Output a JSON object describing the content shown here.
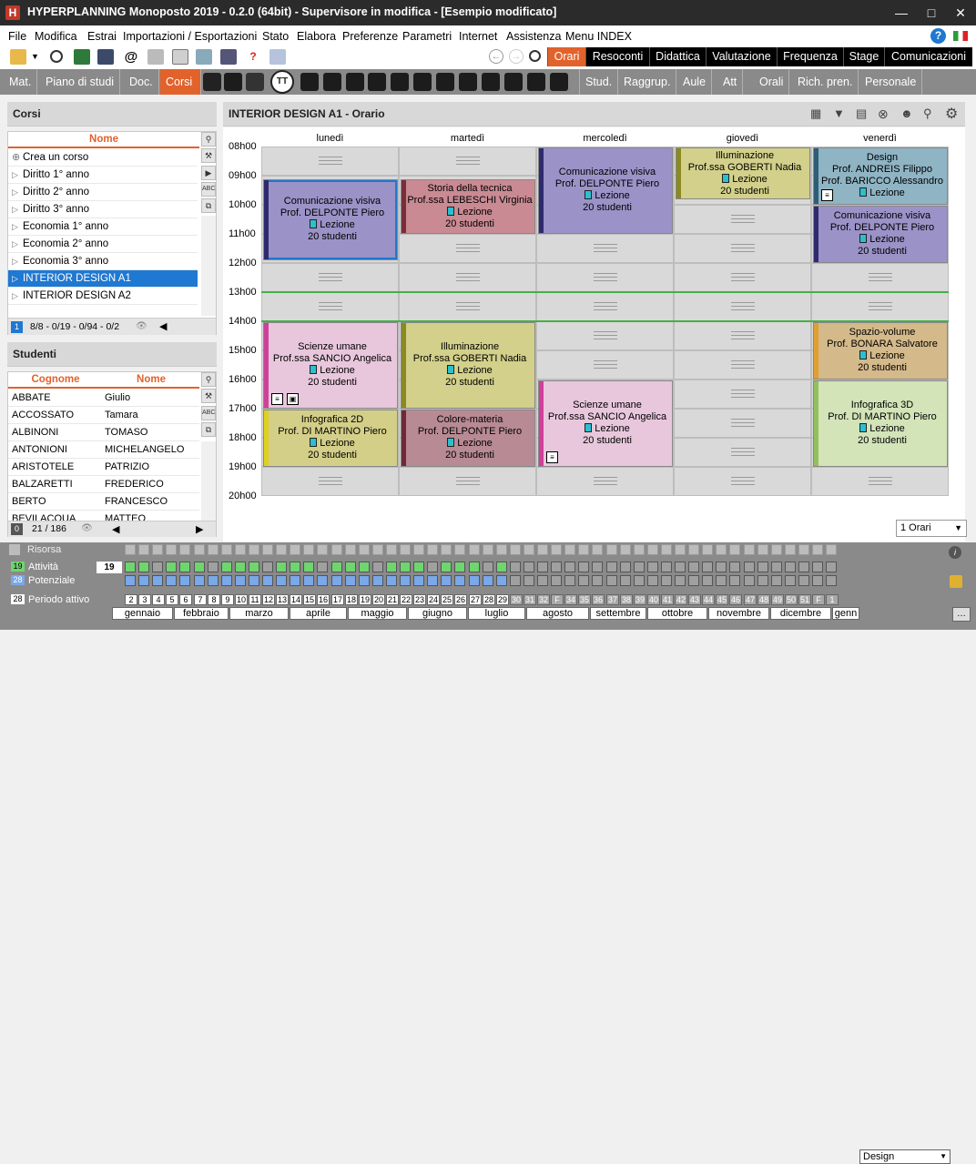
{
  "window": {
    "title": "HYPERPLANNING Monoposto 2019 - 0.2.0 (64bit) - Supervisore in modifica - [Esempio modificato]",
    "logo": "H"
  },
  "menu": [
    "File",
    "Modifica",
    "Estrai",
    "Importazioni / Esportazioni",
    "Stato",
    "Elabora",
    "Preferenze",
    "Parametri",
    "Internet",
    "Assistenza",
    "Menu INDEX"
  ],
  "top_tabs": [
    "Orari",
    "Resoconti",
    "Didattica",
    "Valutazione",
    "Frequenza",
    "Stage",
    "Comunicazioni"
  ],
  "nav2_left": [
    "Mat.",
    "Piano di studi",
    "Doc.",
    "Corsi"
  ],
  "nav2_right": [
    "Stud.",
    "Raggrup.",
    "Aule",
    "Att",
    "Orali",
    "Rich. pren.",
    "Personale"
  ],
  "corsi": {
    "header": "Corsi",
    "column": "Nome",
    "items": [
      "Crea un corso",
      "Diritto 1° anno",
      "Diritto 2° anno",
      "Diritto 3° anno",
      "Economia 1° anno",
      "Economia 2° anno",
      "Economia 3° anno",
      "INTERIOR DESIGN A1",
      "INTERIOR DESIGN A2"
    ],
    "footer_num": "1",
    "footer_text": "8/8 - 0/19 - 0/94 - 0/2"
  },
  "studenti": {
    "header": "Studenti",
    "col1": "Cognome",
    "col2": "Nome",
    "rows": [
      [
        "ABBATE",
        "Giulio"
      ],
      [
        "ACCOSSATO",
        "Tamara"
      ],
      [
        "ALBINONI",
        "TOMASO"
      ],
      [
        "ANTONIONI",
        "MICHELANGELO"
      ],
      [
        "ARISTOTELE",
        "PATRIZIO"
      ],
      [
        "BALZARETTI",
        "FREDERICO"
      ],
      [
        "BERTO",
        "FRANCESCO"
      ],
      [
        "BEVILACQUA",
        "MATTEO"
      ]
    ],
    "footer_num": "0",
    "footer_text": "21 / 186"
  },
  "schedule": {
    "title": "INTERIOR DESIGN A1 - Orario",
    "days": [
      "lunedì",
      "martedì",
      "mercoledì",
      "giovedì",
      "venerdì"
    ],
    "hours": [
      "08h00",
      "09h00",
      "10h00",
      "11h00",
      "12h00",
      "13h00",
      "14h00",
      "15h00",
      "16h00",
      "17h00",
      "18h00",
      "19h00",
      "20h00"
    ],
    "lesson_label": "Lezione",
    "courses": [
      {
        "subject": "Comunicazione visiva",
        "teacher": "Prof. DELPONTE Piero",
        "students": "20 studenti",
        "color": "#9b92c7",
        "bar": "#2e2a6e",
        "day": 0,
        "start": 9.1,
        "end": 11.9,
        "icons": []
      },
      {
        "subject": "Storia della tecnica",
        "teacher": "Prof.ssa LEBESCHI Virginia",
        "students": "20 studenti",
        "color": "#c98a93",
        "bar": "#7a2e3a",
        "day": 1,
        "start": 9.1,
        "end": 11.0,
        "icons": []
      },
      {
        "subject": "Comunicazione visiva",
        "teacher": "Prof. DELPONTE Piero",
        "students": "20 studenti",
        "color": "#9b92c7",
        "bar": "#2e2a6e",
        "day": 2,
        "start": 8.0,
        "end": 11.0,
        "icons": []
      },
      {
        "subject": "Illuminazione",
        "teacher": "Prof.ssa GOBERTI Nadia",
        "students": "20 studenti",
        "color": "#d2d08a",
        "bar": "#8a8a20",
        "day": 3,
        "start": 8.0,
        "end": 9.8,
        "icons": []
      },
      {
        "subject": "Design",
        "teacher": "Prof. ANDREIS Filippo",
        "teacher2": "Prof. BARICCO Alessandro",
        "students": "",
        "color": "#8fb4c4",
        "bar": "#2e5e74",
        "day": 4,
        "start": 8.0,
        "end": 10.0,
        "icons": [
          "doc"
        ]
      },
      {
        "subject": "Comunicazione visiva",
        "teacher": "Prof. DELPONTE Piero",
        "students": "20 studenti",
        "color": "#9b92c7",
        "bar": "#2e2a6e",
        "day": 4,
        "start": 10.0,
        "end": 12.0,
        "icons": []
      },
      {
        "subject": "Scienze umane",
        "teacher": "Prof.ssa SANCIO Angelica",
        "students": "20 studenti",
        "color": "#e8c7dc",
        "bar": "#d0409a",
        "day": 0,
        "start": 14.0,
        "end": 17.0,
        "icons": [
          "doc",
          "lock"
        ]
      },
      {
        "subject": "Illuminazione",
        "teacher": "Prof.ssa GOBERTI Nadia",
        "students": "20 studenti",
        "color": "#d2d08a",
        "bar": "#8a8a20",
        "day": 1,
        "start": 14.0,
        "end": 17.0,
        "icons": []
      },
      {
        "subject": "Spazio-volume",
        "teacher": "Prof. BONARA Salvatore",
        "students": "20 studenti",
        "color": "#d4b98a",
        "bar": "#e0a030",
        "day": 4,
        "start": 14.0,
        "end": 16.0,
        "icons": []
      },
      {
        "subject": "Scienze umane",
        "teacher": "Prof.ssa SANCIO Angelica",
        "students": "20 studenti",
        "color": "#e8c7dc",
        "bar": "#d0409a",
        "day": 2,
        "start": 16.0,
        "end": 19.0,
        "icons": [
          "doc"
        ]
      },
      {
        "subject": "Infografica 2D",
        "teacher": "Prof. DI MARTINO Piero",
        "students": "20 studenti",
        "color": "#d4cf88",
        "bar": "#e0d020",
        "day": 0,
        "start": 17.0,
        "end": 19.0,
        "icons": []
      },
      {
        "subject": "Colore-materia",
        "teacher": "Prof. DELPONTE Piero",
        "students": "20 studenti",
        "color": "#b88a94",
        "bar": "#6e2a3a",
        "day": 1,
        "start": 17.0,
        "end": 19.0,
        "icons": []
      },
      {
        "subject": "Infografica 3D",
        "teacher": "Prof. DI MARTINO Piero",
        "students": "20 studenti",
        "color": "#d2e4b8",
        "bar": "#90c060",
        "day": 4,
        "start": 16.0,
        "end": 19.0,
        "icons": []
      }
    ],
    "view_select": "1 Orari"
  },
  "bottom": {
    "risorsa": "Risorsa",
    "attivita_num": "19",
    "attivita": "Attività",
    "attivita_value": "19",
    "potenziale_num": "28",
    "potenziale": "Potenziale",
    "periodo_num": "28",
    "periodo": "Periodo attivo",
    "days": [
      "2",
      "3",
      "4",
      "5",
      "6",
      "7",
      "8",
      "9",
      "10",
      "11",
      "12",
      "13",
      "14",
      "15",
      "16",
      "17",
      "18",
      "19",
      "20",
      "21",
      "22",
      "23",
      "24",
      "25",
      "26",
      "27",
      "28",
      "29",
      "30",
      "31",
      "32",
      "F",
      "34",
      "35",
      "36",
      "37",
      "38",
      "39",
      "40",
      "41",
      "42",
      "43",
      "44",
      "45",
      "46",
      "47",
      "48",
      "49",
      "50",
      "51",
      "F",
      "1"
    ],
    "months": [
      "gennaio",
      "febbraio",
      "marzo",
      "aprile",
      "maggio",
      "giugno",
      "luglio",
      "agosto",
      "settembre",
      "ottobre",
      "novembre",
      "dicembre",
      "genn"
    ],
    "filter": "Design"
  }
}
